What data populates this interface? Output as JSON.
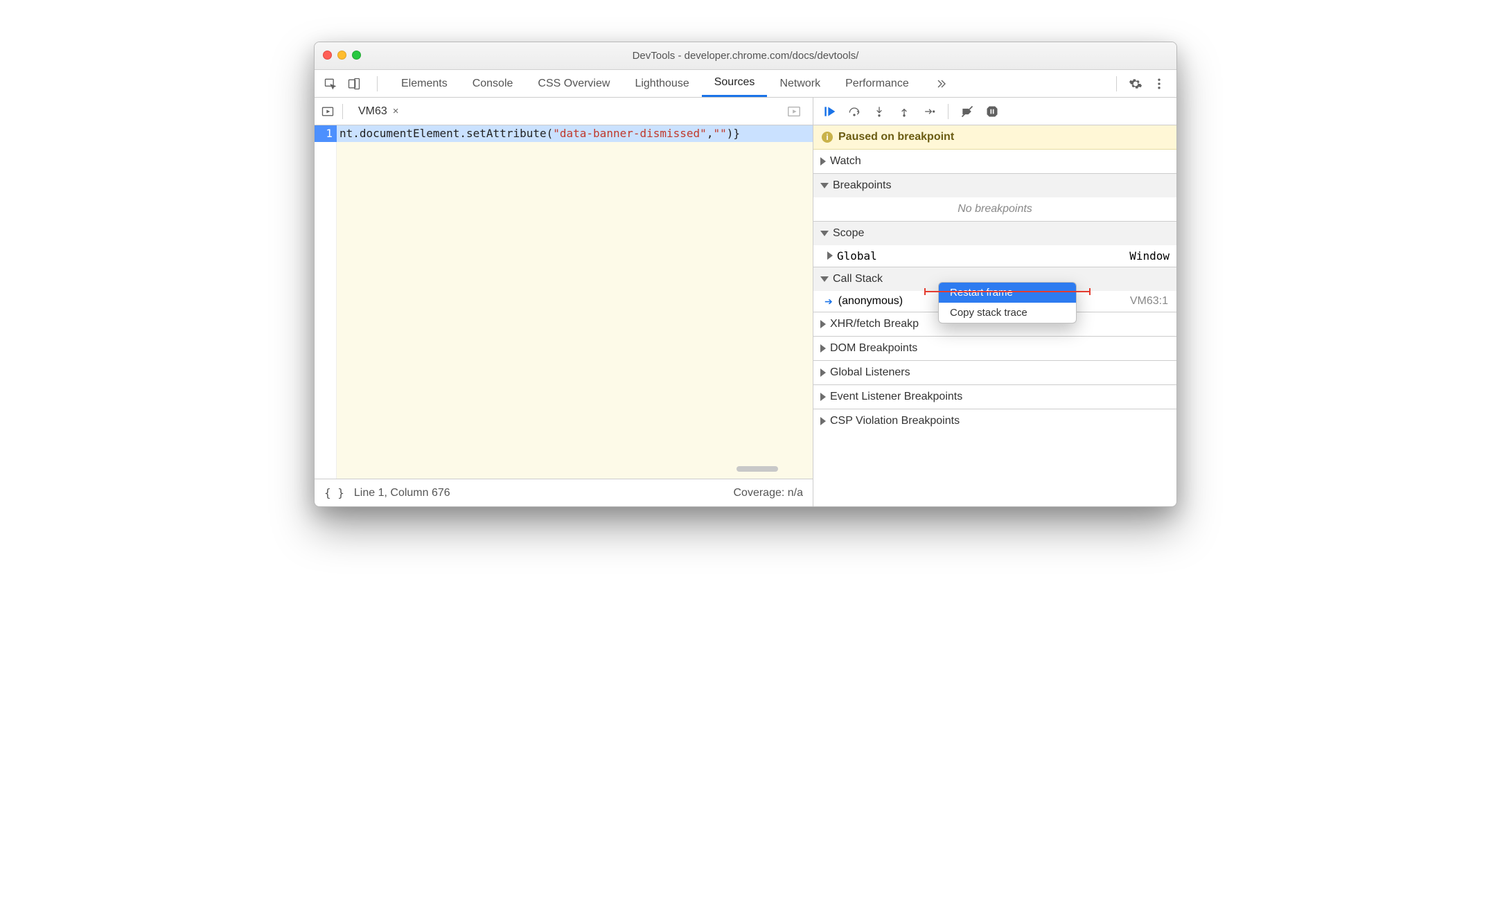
{
  "window": {
    "title": "DevTools - developer.chrome.com/docs/devtools/"
  },
  "tabs": {
    "items": [
      "Elements",
      "Console",
      "CSS Overview",
      "Lighthouse",
      "Sources",
      "Network",
      "Performance"
    ],
    "active": "Sources"
  },
  "editor": {
    "file_tab": "VM63",
    "line_number": "1",
    "code_prefix": "nt.documentElement.setAttribute(",
    "code_string": "\"data-banner-dismissed\"",
    "code_mid": ",",
    "code_string2": "\"\"",
    "code_suffix": ")}"
  },
  "statusbar": {
    "braces": "{ }",
    "position": "Line 1, Column 676",
    "coverage": "Coverage: n/a"
  },
  "debugger": {
    "paused_label": "Paused on breakpoint",
    "sections": {
      "watch": "Watch",
      "breakpoints": "Breakpoints",
      "no_breakpoints": "No breakpoints",
      "scope": "Scope",
      "scope_global": "Global",
      "scope_global_value": "Window",
      "call_stack": "Call Stack",
      "call_anon": "(anonymous)",
      "call_loc": "VM63:1",
      "xhr": "XHR/fetch Breakp",
      "dom": "DOM Breakpoints",
      "global_listeners": "Global Listeners",
      "event_listener": "Event Listener Breakpoints",
      "csp": "CSP Violation Breakpoints"
    }
  },
  "context_menu": {
    "restart_frame": "Restart frame",
    "copy_stack": "Copy stack trace"
  }
}
